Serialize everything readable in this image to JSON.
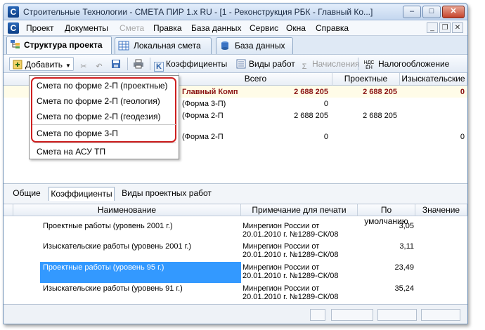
{
  "window": {
    "title": "Строительные Технологии - СМЕТА ПИР 1.х RU - [1 - Реконструкция РБК - Главный Ко...]",
    "app_icon": "С",
    "controls": {
      "minimize": "–",
      "maximize": "□",
      "close": "✕"
    }
  },
  "menu": {
    "items": [
      "Проект",
      "Документы",
      "Смета",
      "Правка",
      "База данных",
      "Сервис",
      "Окна",
      "Справка"
    ],
    "disabled_index": 2,
    "mdi_controls": {
      "minimize": "_",
      "restore": "❐",
      "close": "✕"
    }
  },
  "doc_tabs": [
    "Структура проекта",
    "Локальная смета",
    "База данных"
  ],
  "toolbar": {
    "add": "Добавить",
    "coefficients": "Коэффициенты",
    "work_types": "Виды работ",
    "accruals": "Начисления",
    "taxation": "Налогообложение",
    "coef_icon": "K",
    "tax_icon_top": "НДС",
    "tax_icon_bottom": "ЕН"
  },
  "top_grid": {
    "headers": [
      "Всего",
      "Проектные",
      "Изыскательские"
    ],
    "rows": [
      {
        "name": "Главный Комп",
        "total": "2 688 205",
        "project": "2 688 205",
        "survey": "0",
        "bold": true
      },
      {
        "name": "(Форма 3-П)",
        "total": "0",
        "project": "",
        "survey": "",
        "bold": false
      },
      {
        "name": "(Форма 2-П",
        "total": "2 688 205",
        "project": "2 688 205",
        "survey": "",
        "bold": false
      },
      {
        "name": "(Форма 2-П",
        "total": "0",
        "project": "",
        "survey": "0",
        "bold": false
      }
    ]
  },
  "dropdown": {
    "items": [
      "Смета по форме 2-П (проектные)",
      "Смета по форме 2-П (геология)",
      "Смета по форме 2-П (геодезия)",
      "Смета по форме 3-П",
      "Смета на АСУ ТП"
    ]
  },
  "lower_tabs": [
    "Общие",
    "Коэффициенты",
    "Виды проектных работ"
  ],
  "bottom_grid": {
    "headers": [
      "Наименование",
      "Примечание для печати",
      "По умолчанию",
      "Значение"
    ],
    "rows": [
      {
        "name": "Проектные работы (уровень 2001 г.)",
        "note1": "Минрегион России от",
        "note2": "20.01.2010 г. №1289-СК/08",
        "default": "3,05",
        "value": ""
      },
      {
        "name": "Изыскательские работы (уровень 2001 г.)",
        "note1": "Минрегион России от",
        "note2": "20.01.2010 г. №1289-СК/08",
        "default": "3,11",
        "value": ""
      },
      {
        "name": "Проектные работы (уровень 95 г.)",
        "note1": "Минрегион России от",
        "note2": "20.01.2010 г. №1289-СК/08",
        "default": "23,49",
        "value": ""
      },
      {
        "name": "Изыскательские работы (уровень 91 г.)",
        "note1": "Минрегион России от",
        "note2": "20.01.2010 г. №1289-СК/08",
        "default": "35,24",
        "value": ""
      }
    ],
    "selected_index": 2
  },
  "colors": {
    "accent": "#3399ff",
    "highlight_frame": "#cf1f1f",
    "title_bar": "#c4d7ef"
  }
}
